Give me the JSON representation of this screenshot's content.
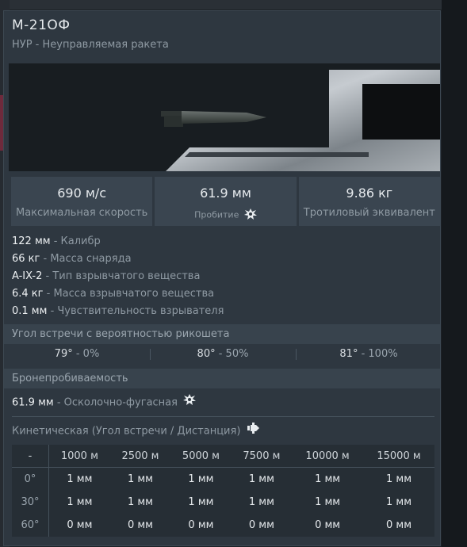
{
  "title": "М-21ОФ",
  "subtitle": "НУР - Неуправляемая ракета",
  "stats": [
    {
      "value": "690 м/с",
      "label": "Максимальная скорость"
    },
    {
      "value": "61.9 мм",
      "label": "Пробитие",
      "icon": "explosion-icon"
    },
    {
      "value": "9.86 кг",
      "label": "Тротиловый эквивалент"
    }
  ],
  "properties": [
    {
      "value": "122 мм",
      "desc": "- Калибр"
    },
    {
      "value": "66 кг",
      "desc": "- Масса снаряда"
    },
    {
      "value": "A-IX-2",
      "desc": "- Тип взрывчатого вещества"
    },
    {
      "value": "6.4 кг",
      "desc": "- Масса взрывчатого вещества"
    },
    {
      "value": "0.1 мм",
      "desc": "- Чувствительность взрывателя"
    }
  ],
  "ricochet": {
    "title": "Угол встречи с вероятностью рикошета",
    "cells": [
      {
        "angle": "79°",
        "pct": " - 0%"
      },
      {
        "angle": "80°",
        "pct": " - 50%"
      },
      {
        "angle": "81°",
        "pct": " - 100%"
      }
    ]
  },
  "penetration": {
    "title": "Бронепробиваемость",
    "he_value": "61.9 мм",
    "he_desc": " - Осколочно-фугасная",
    "kinetic_title": "Кинетическая (Угол встречи / Дистанция)",
    "table": {
      "corner": "-",
      "distances": [
        "1000 м",
        "2500 м",
        "5000 м",
        "7500 м",
        "10000 м",
        "15000 м"
      ],
      "rows": [
        {
          "angle": "0°",
          "values": [
            "1 мм",
            "1 мм",
            "1 мм",
            "1 мм",
            "1 мм",
            "1 мм"
          ]
        },
        {
          "angle": "30°",
          "values": [
            "1 мм",
            "1 мм",
            "1 мм",
            "1 мм",
            "1 мм",
            "1 мм"
          ]
        },
        {
          "angle": "60°",
          "values": [
            "0 мм",
            "0 мм",
            "0 мм",
            "0 мм",
            "0 мм",
            "0 мм"
          ]
        }
      ]
    }
  }
}
